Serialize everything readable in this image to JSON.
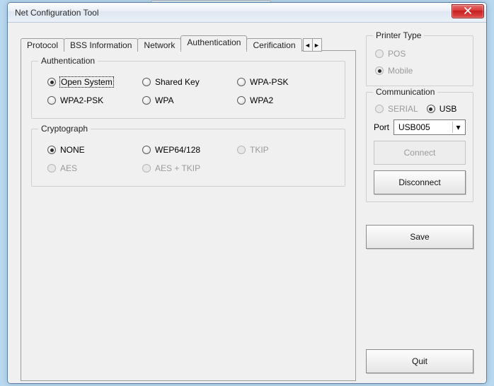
{
  "window": {
    "title": "Net Configuration Tool"
  },
  "tabs": {
    "items": [
      {
        "label": "Protocol"
      },
      {
        "label": "BSS Information"
      },
      {
        "label": "Network"
      },
      {
        "label": "Authentication"
      },
      {
        "label": "Cerification"
      }
    ],
    "active_index": 3
  },
  "authentication": {
    "group_title": "Authentication",
    "options": {
      "open_system": "Open System",
      "shared_key": "Shared Key",
      "wpa_psk": "WPA-PSK",
      "wpa2_psk": "WPA2-PSK",
      "wpa": "WPA",
      "wpa2": "WPA2"
    }
  },
  "cryptograph": {
    "group_title": "Cryptograph",
    "options": {
      "none": "NONE",
      "wep": "WEP64/128",
      "tkip": "TKIP",
      "aes": "AES",
      "aes_tkip": "AES + TKIP"
    }
  },
  "printer_type": {
    "group_title": "Printer Type",
    "pos": "POS",
    "mobile": "Mobile"
  },
  "communication": {
    "group_title": "Communication",
    "serial": "SERIAL",
    "usb": "USB",
    "port_label": "Port",
    "port_value": "USB005",
    "connect": "Connect",
    "disconnect": "Disconnect"
  },
  "buttons": {
    "save": "Save",
    "quit": "Quit"
  }
}
